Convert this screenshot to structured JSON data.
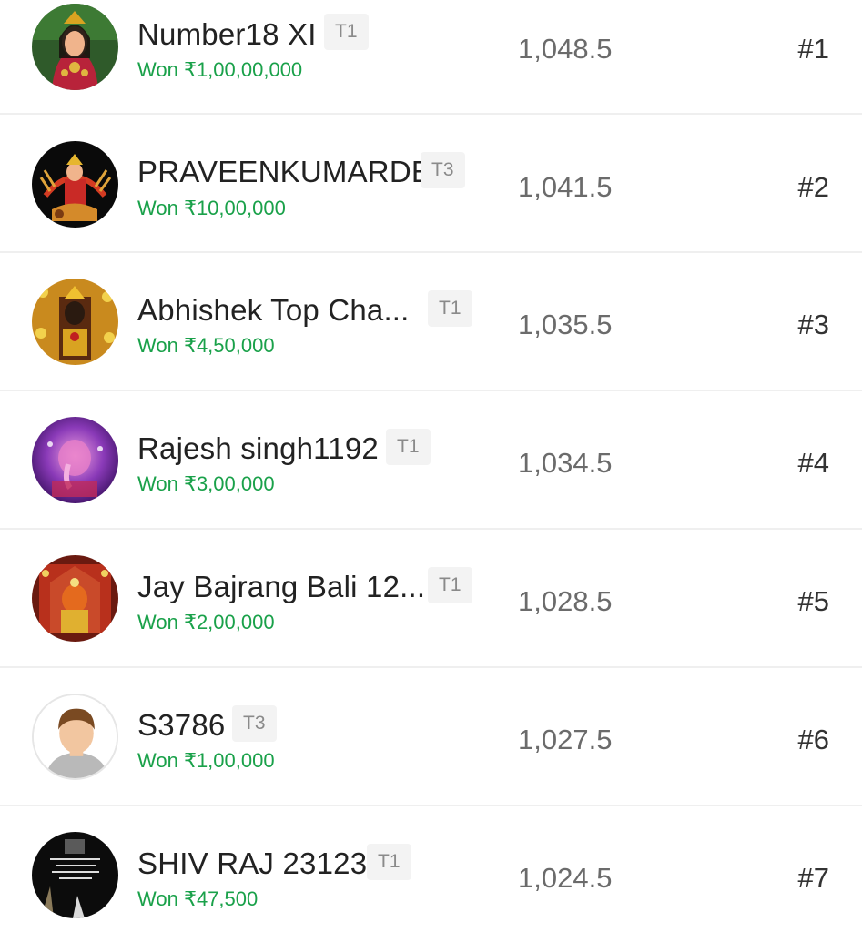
{
  "leaderboard": [
    {
      "name": "Number18 XI",
      "team": "T1",
      "won": "Won ₹1,00,00,000",
      "points": "1,048.5",
      "rank": "#1",
      "avatar": "goddess-photo-avatar"
    },
    {
      "name": "PRAVEENKUMARDE",
      "team": "T3",
      "won": "Won ₹10,00,000",
      "points": "1,041.5",
      "rank": "#2",
      "avatar": "durga-photo-avatar"
    },
    {
      "name": "Abhishek Top Cha...",
      "team": "T1",
      "won": "Won ₹4,50,000",
      "points": "1,035.5",
      "rank": "#3",
      "avatar": "deity-photo-avatar"
    },
    {
      "name": "Rajesh singh1192",
      "team": "T1",
      "won": "Won ₹3,00,000",
      "points": "1,034.5",
      "rank": "#4",
      "avatar": "ganesh-photo-avatar"
    },
    {
      "name": "Jay Bajrang Bali 12...",
      "team": "T1",
      "won": "Won ₹2,00,000",
      "points": "1,028.5",
      "rank": "#5",
      "avatar": "hanuman-photo-avatar"
    },
    {
      "name": "S3786",
      "team": "T3",
      "won": "Won ₹1,00,000",
      "points": "1,027.5",
      "rank": "#6",
      "avatar": "default-user-avatar"
    },
    {
      "name": "SHIV RAJ 23123",
      "team": "T1",
      "won": "Won ₹47,500",
      "points": "1,024.5",
      "rank": "#7",
      "avatar": "quote-photo-avatar"
    }
  ],
  "colors": {
    "won_text": "#1aa14a",
    "name_text": "#222222",
    "points_text": "#6b6b6b",
    "rank_text": "#333333",
    "team_badge_bg": "#f3f3f3",
    "divider": "#efefef"
  }
}
